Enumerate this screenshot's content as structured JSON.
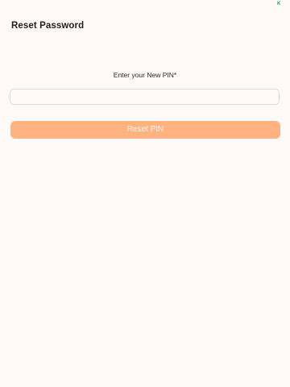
{
  "header": {
    "title": "Reset Password",
    "status_indicator": "K"
  },
  "form": {
    "pin_label": "Enter your New PIN*",
    "pin_value": "",
    "pin_placeholder": "",
    "submit_label": "Reset PIN"
  },
  "colors": {
    "background": "#fffaf7",
    "button": "#ffb381",
    "button_text": "#fff6ef",
    "indicator": "#1fa44a"
  }
}
